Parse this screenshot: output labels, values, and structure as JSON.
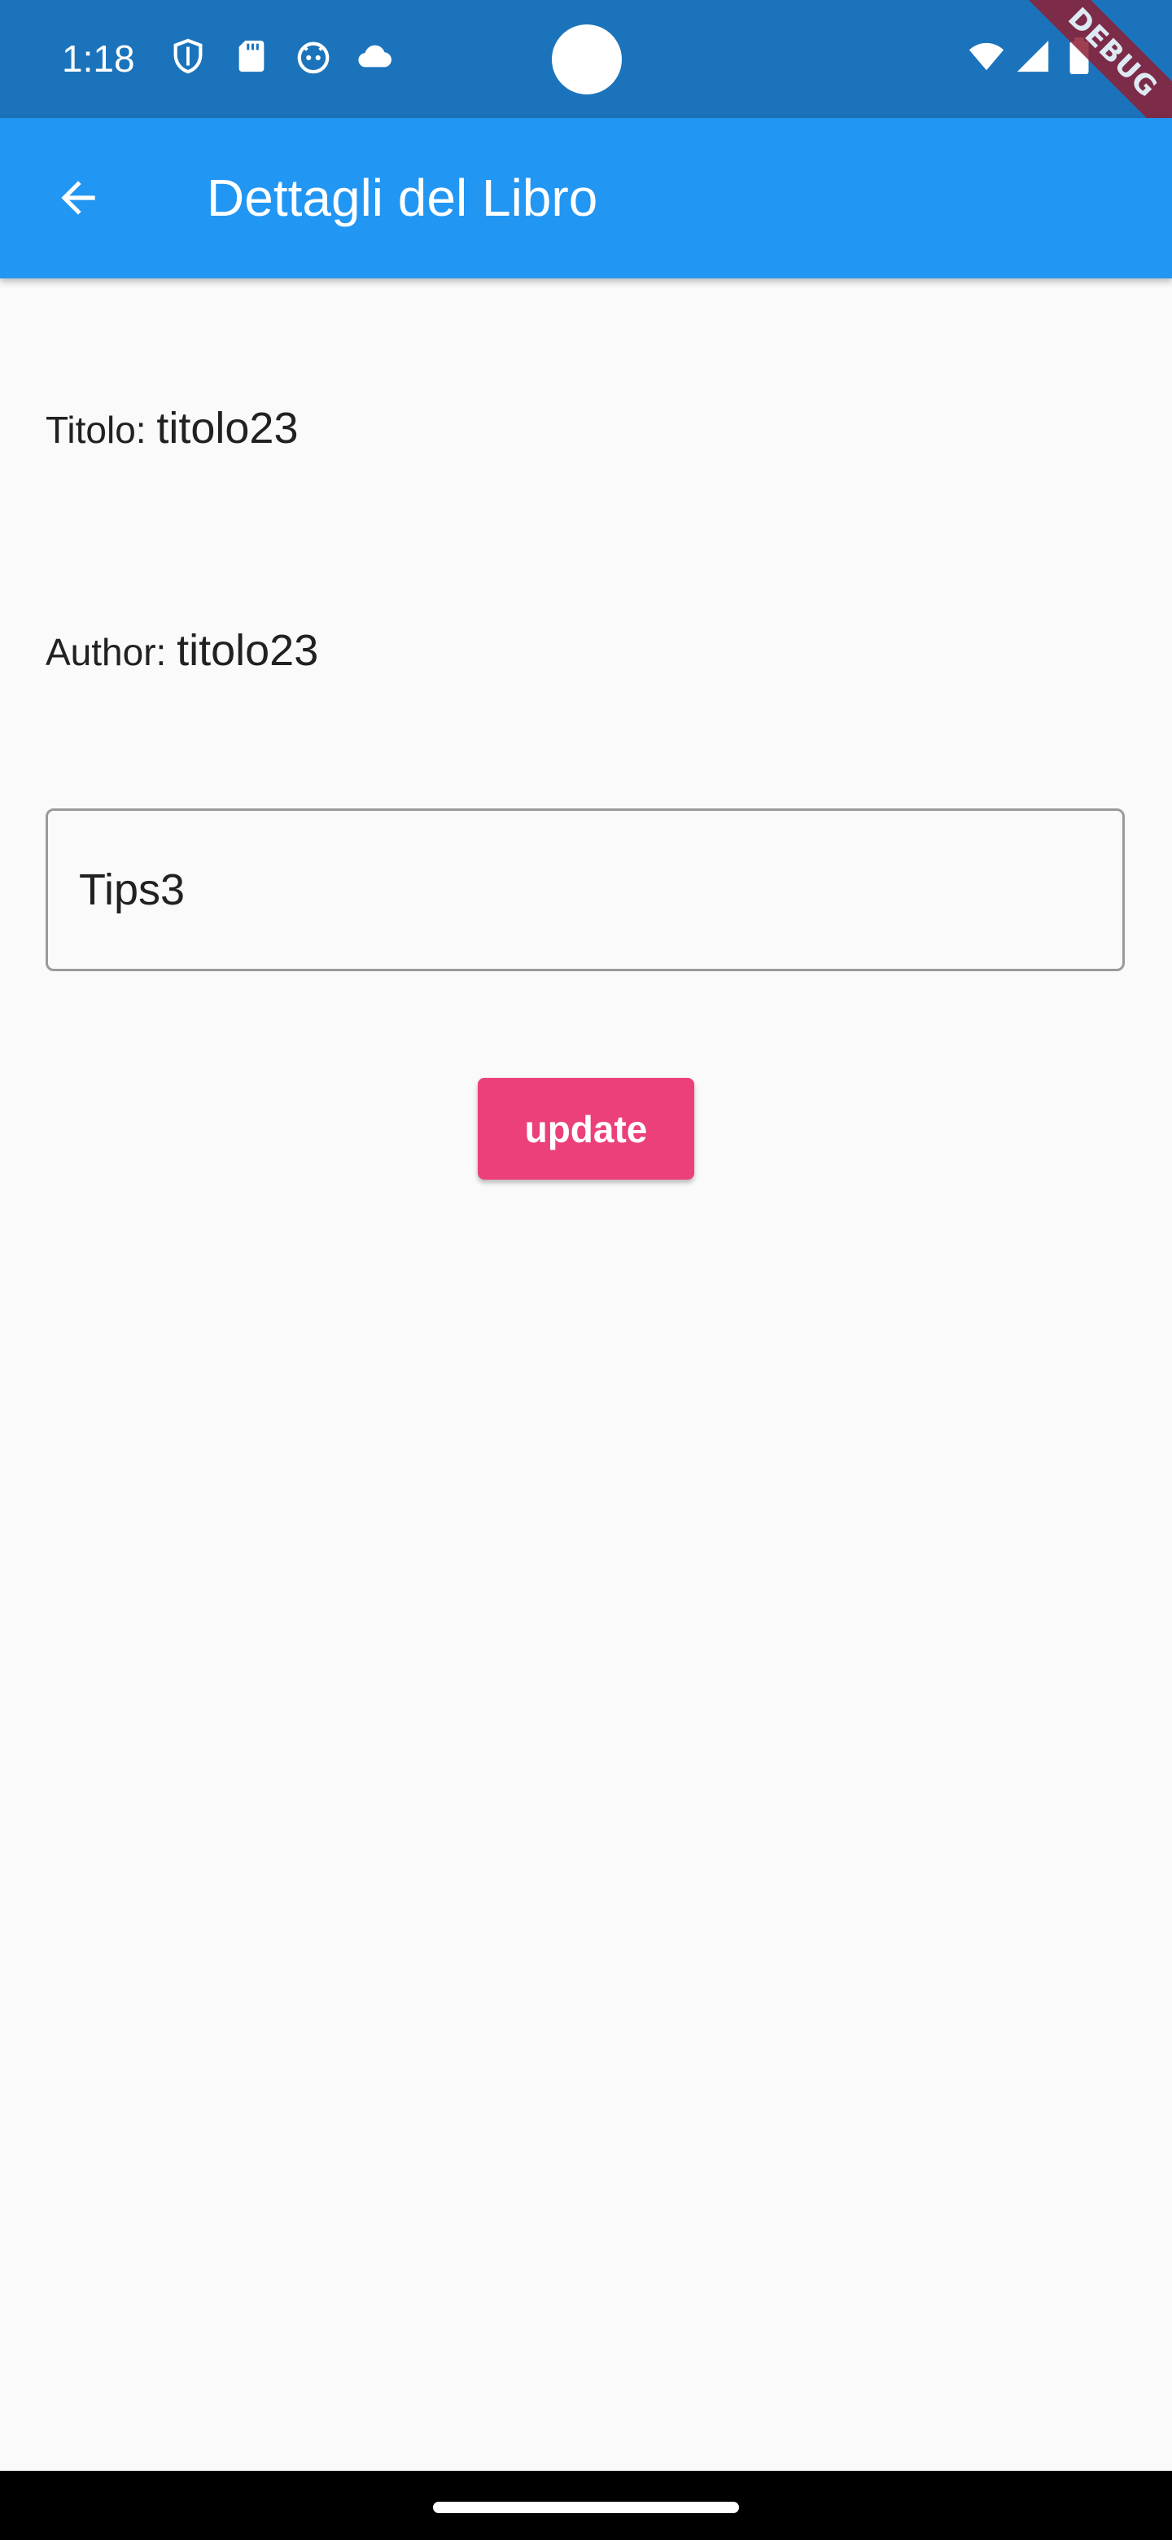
{
  "status_bar": {
    "time": "1:18",
    "background_color": "#1b74bb",
    "left_icons": [
      "shield-icon",
      "sd-card-icon",
      "robot-face-icon",
      "cloud-icon"
    ],
    "right_icons": [
      "wifi-icon",
      "cellular-signal-icon",
      "battery-icon"
    ]
  },
  "debug_banner": {
    "label": "DEBUG"
  },
  "app_bar": {
    "title": "Dettagli del Libro",
    "background_color": "#2196f3",
    "back_icon": "arrow-back-icon"
  },
  "details": {
    "title_label": "Titolo: ",
    "title_value": "titolo23",
    "author_label": "Author: ",
    "author_value": "titolo23"
  },
  "tips_input": {
    "value": "Tips3"
  },
  "update_button": {
    "label": "update",
    "color": "#ec407a"
  }
}
